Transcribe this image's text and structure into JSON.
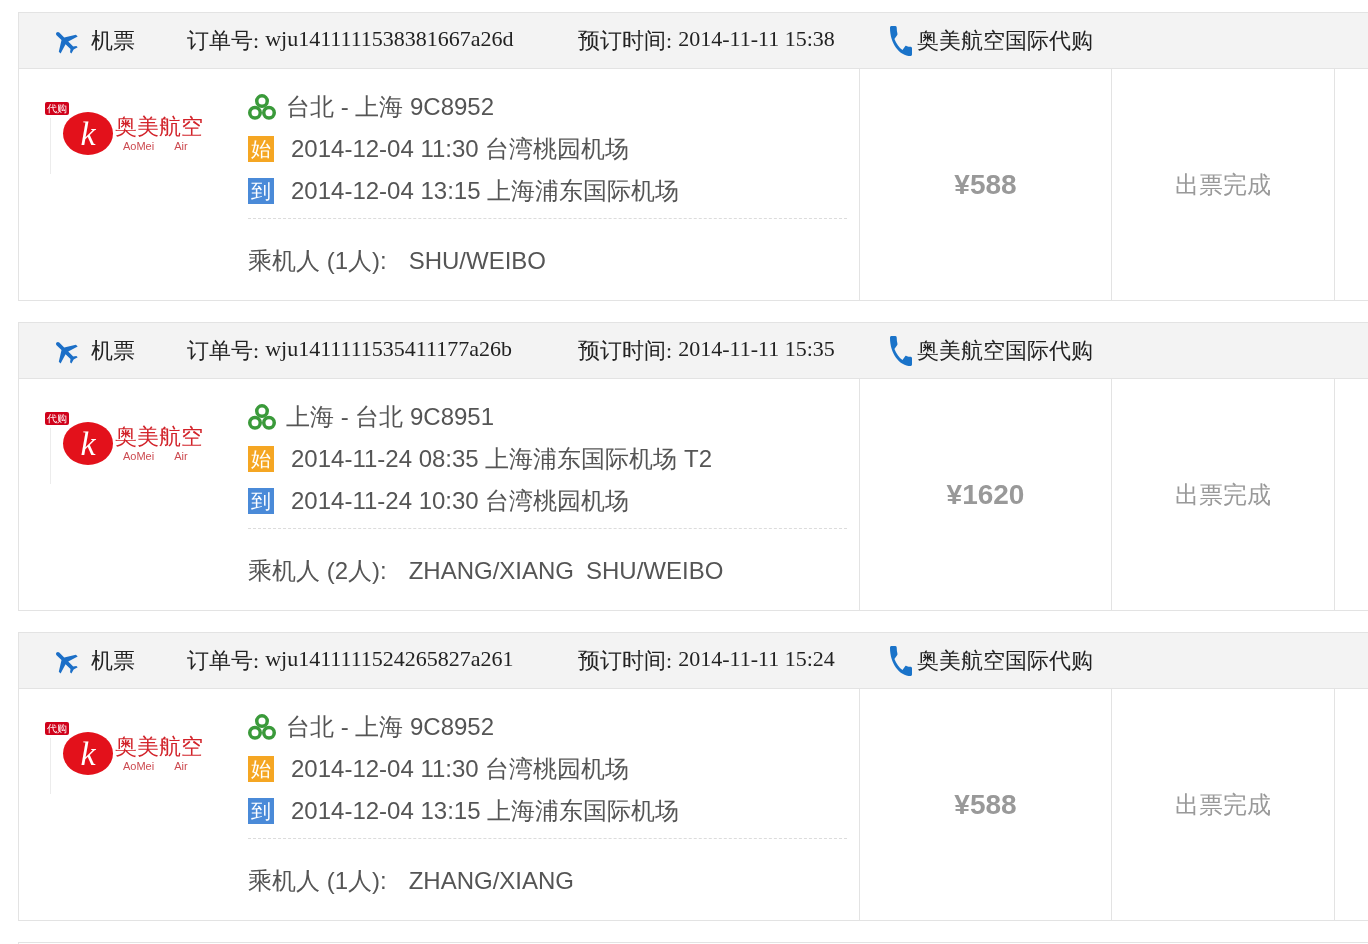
{
  "orders": [
    {
      "header": {
        "category": "机票",
        "order_label": "订单号:",
        "order_no": "wju1411111538381667a26d",
        "time_label": "预订时间:",
        "time": "2014-11-11 15:38",
        "seller": "奥美航空国际代购"
      },
      "logo": {
        "badge": "代购",
        "emblem": "k",
        "name": "奥美航空",
        "latin": [
          "AoMei",
          "Air"
        ]
      },
      "flight": {
        "route": "台北 - 上海 9C8952",
        "legs": [
          {
            "badge": "始",
            "color": "#f5a623",
            "text": "2014-12-04 11:30 台湾桃园机场"
          },
          {
            "badge": "到",
            "color": "#4a8ad8",
            "text": "2014-12-04 13:15 上海浦东国际机场"
          }
        ],
        "passengers_label": "乘机人 (1人):",
        "passengers": [
          "SHU/WEIBO"
        ]
      },
      "price": "¥588",
      "status": "出票完成"
    },
    {
      "header": {
        "category": "机票",
        "order_label": "订单号:",
        "order_no": "wju1411111535411177a26b",
        "time_label": "预订时间:",
        "time": "2014-11-11 15:35",
        "seller": "奥美航空国际代购"
      },
      "logo": {
        "badge": "代购",
        "emblem": "k",
        "name": "奥美航空",
        "latin": [
          "AoMei",
          "Air"
        ]
      },
      "flight": {
        "route": "上海 - 台北 9C8951",
        "legs": [
          {
            "badge": "始",
            "color": "#f5a623",
            "text": "2014-11-24 08:35 上海浦东国际机场 T2"
          },
          {
            "badge": "到",
            "color": "#4a8ad8",
            "text": "2014-11-24 10:30 台湾桃园机场"
          }
        ],
        "passengers_label": "乘机人 (2人):",
        "passengers": [
          "ZHANG/XIANG",
          "SHU/WEIBO"
        ]
      },
      "price": "¥1620",
      "status": "出票完成"
    },
    {
      "header": {
        "category": "机票",
        "order_label": "订单号:",
        "order_no": "wju1411111524265827a261",
        "time_label": "预订时间:",
        "time": "2014-11-11 15:24",
        "seller": "奥美航空国际代购"
      },
      "logo": {
        "badge": "代购",
        "emblem": "k",
        "name": "奥美航空",
        "latin": [
          "AoMei",
          "Air"
        ]
      },
      "flight": {
        "route": "台北 - 上海 9C8952",
        "legs": [
          {
            "badge": "始",
            "color": "#f5a623",
            "text": "2014-12-04 11:30 台湾桃园机场"
          },
          {
            "badge": "到",
            "color": "#4a8ad8",
            "text": "2014-12-04 13:15 上海浦东国际机场"
          }
        ],
        "passengers_label": "乘机人 (1人):",
        "passengers": [
          "ZHANG/XIANG"
        ]
      },
      "price": "¥588",
      "status": "出票完成"
    }
  ]
}
